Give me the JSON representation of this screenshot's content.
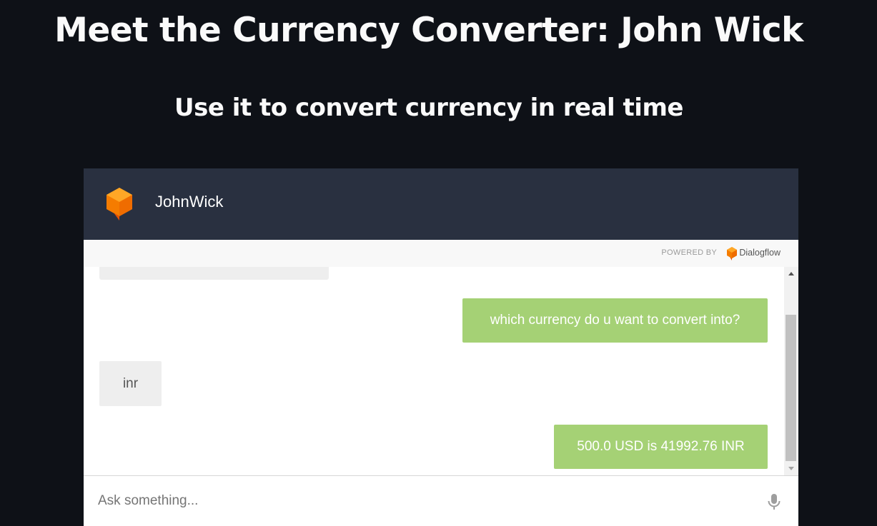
{
  "header": {
    "title": "Meet the Currency Converter: John Wick",
    "subtitle": "Use it to convert currency in real time"
  },
  "chat": {
    "bot_name": "JohnWick",
    "powered_by": "POWERED BY",
    "provider_name": "Dialogflow",
    "messages": [
      {
        "sender": "user",
        "text": ""
      },
      {
        "sender": "bot",
        "text": "which currency do u want to convert into?"
      },
      {
        "sender": "user",
        "text": "inr"
      },
      {
        "sender": "bot",
        "text": "500.0 USD is 41992.76 INR"
      }
    ],
    "input": {
      "placeholder": "Ask something...",
      "value": ""
    }
  },
  "icons": {
    "bot_avatar": "dialogflow-cube-icon",
    "provider_logo": "dialogflow-logo-icon",
    "mic": "microphone-icon"
  },
  "colors": {
    "page_background": "#0e1117",
    "header_background": "#293040",
    "bot_bubble": "#a5d175",
    "user_bubble": "#eeeeee",
    "brand_orange": "#ff9800"
  }
}
